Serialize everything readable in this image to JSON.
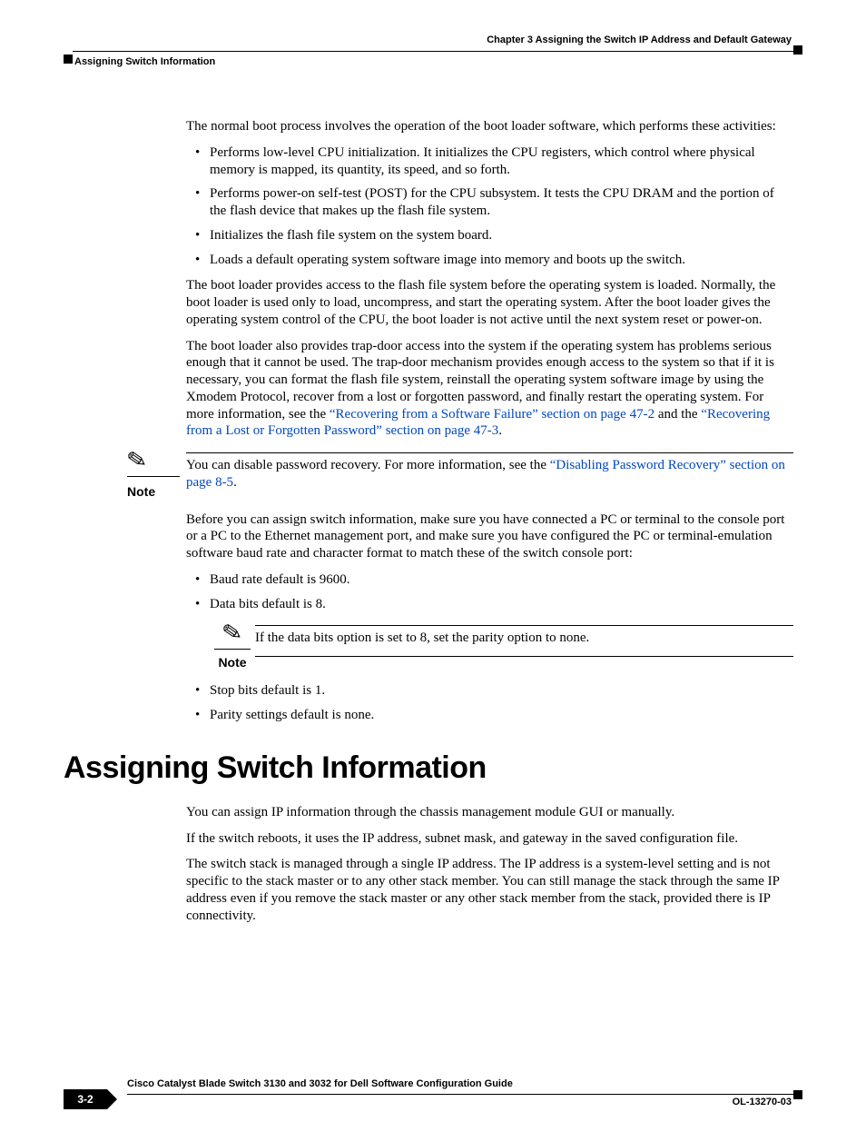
{
  "header": {
    "chapter": "Chapter 3      Assigning the Switch IP Address and Default Gateway",
    "section": "Assigning Switch Information"
  },
  "body": {
    "intro": "The normal boot process involves the operation of the boot loader software, which performs these activities:",
    "bullets1": [
      "Performs low-level CPU initialization. It initializes the CPU registers, which control where physical memory is mapped, its quantity, its speed, and so forth.",
      "Performs power-on self-test (POST) for the CPU subsystem. It tests the CPU DRAM and the portion of the flash device that makes up the flash file system.",
      "Initializes the flash file system on the system board.",
      "Loads a default operating system software image into memory and boots up the switch."
    ],
    "p2": "The boot loader provides access to the flash file system before the operating system is loaded. Normally, the boot loader is used only to load, uncompress, and start the operating system. After the boot loader gives the operating system control of the CPU, the boot loader is not active until the next system reset or power-on.",
    "p3a": "The boot loader also provides trap-door access into the system if the operating system has problems serious enough that it cannot be used. The trap-door mechanism provides enough access to the system so that if it is necessary, you can format the flash file system, reinstall the operating system software image by using the Xmodem Protocol, recover from a lost or forgotten password, and finally restart the operating system. For more information, see the ",
    "link1": "“Recovering from a Software Failure” section on page 47-2",
    "p3b": " and the ",
    "link2": "“Recovering from a Lost or Forgotten Password” section on page 47-3",
    "p3c": ".",
    "note1a": "You can disable password recovery. For more information, see the ",
    "note1link": "“Disabling Password Recovery” section on page 8-5",
    "note1b": ".",
    "p4": "Before you can assign switch information, make sure you have connected a PC or terminal to the console port or a PC to the Ethernet management port, and make sure you have configured the PC or terminal-emulation software baud rate and character format to match these of the switch console port:",
    "bullets2": [
      "Baud rate default is 9600.",
      "Data bits default is 8."
    ],
    "note2": "If the data bits option is set to 8, set the parity option to none.",
    "bullets3": [
      "Stop bits default is 1.",
      "Parity settings default is none."
    ],
    "h1": "Assigning Switch Information",
    "p5": "You can assign IP information through the chassis management module GUI or manually.",
    "p6": "If the switch reboots, it uses the IP address, subnet mask, and gateway in the saved configuration file.",
    "p7": "The switch stack is managed through a single IP address. The IP address is a system-level setting and is not specific to the stack master or to any other stack member. You can still manage the stack through the same IP address even if you remove the stack master or any other stack member from the stack, provided there is IP connectivity."
  },
  "labels": {
    "note": "Note"
  },
  "footer": {
    "title": "Cisco Catalyst Blade Switch 3130 and 3032 for Dell Software Configuration Guide",
    "page": "3-2",
    "doc": "OL-13270-03"
  }
}
